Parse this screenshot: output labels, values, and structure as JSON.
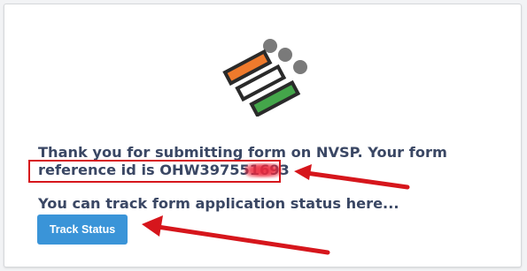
{
  "message": {
    "line1": "Thank you for submitting form on NVSP. Your form",
    "line2_prefix": "reference id is ",
    "reference_id_visible": "OHW397551693"
  },
  "track": {
    "text": "You can track form application status here...",
    "button_label": "Track Status"
  },
  "logo": {
    "icon": "eci-ballot-logo-icon",
    "colors": {
      "orange": "#ef7a2c",
      "white": "#ffffff",
      "green": "#44a64a",
      "outline": "#2a2a2a",
      "dots": "#7a7a7a"
    }
  },
  "colors": {
    "text": "#3a4764",
    "button": "#3a94d8",
    "annotation_red": "#d6161c"
  }
}
